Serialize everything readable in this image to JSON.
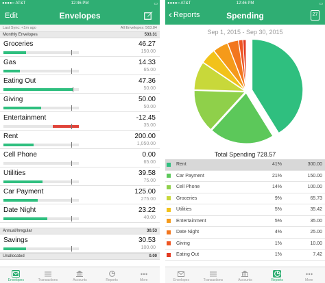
{
  "left": {
    "status": {
      "carrier": "●●●●○ AT&T",
      "time": "12:46 PM",
      "battery": "▭"
    },
    "nav": {
      "edit": "Edit",
      "title": "Envelopes",
      "edit_icon": "compose-icon"
    },
    "sync": {
      "last": "Last Sync: <1m ago",
      "all": "All Envelopes: 563.84"
    },
    "sections": {
      "monthly": {
        "label": "Monthly Envelopes",
        "value": "533.31"
      },
      "annual": {
        "label": "Annual/Irregular",
        "value": "30.53"
      },
      "unalloc": {
        "label": "Unallocated",
        "value": "0.00"
      }
    },
    "envelopes": [
      {
        "name": "Groceries",
        "balance": "46.27",
        "budget": "150.00",
        "fill": 0.3,
        "tick": 0.9,
        "color": "#2fbf7f"
      },
      {
        "name": "Gas",
        "balance": "14.33",
        "budget": "65.00",
        "fill": 0.22,
        "tick": 0.9,
        "color": "#2fbf7f"
      },
      {
        "name": "Eating Out",
        "balance": "47.36",
        "budget": "50.00",
        "fill": 0.93,
        "tick": 0.92,
        "color": "#2fbf7f"
      },
      {
        "name": "Giving",
        "balance": "50.00",
        "budget": "50.00",
        "fill": 0.5,
        "tick": 0.9,
        "color": "#2fbf7f"
      },
      {
        "name": "Entertainment",
        "balance": "-12.45",
        "budget": "35.00",
        "fill": 0.35,
        "fillStart": 0.65,
        "tick": 0.9,
        "color": "#e0443a"
      },
      {
        "name": "Rent",
        "balance": "200.00",
        "budget": "1,050.00",
        "fill": 0.4,
        "tick": 0.9,
        "color": "#2fbf7f"
      },
      {
        "name": "Cell Phone",
        "balance": "0.00",
        "budget": "65.00",
        "fill": 0.0,
        "tick": 0.9,
        "color": "#2fbf7f"
      },
      {
        "name": "Utilities",
        "balance": "39.58",
        "budget": "75.00",
        "fill": 0.52,
        "tick": 0.9,
        "color": "#2fbf7f"
      },
      {
        "name": "Car Payment",
        "balance": "125.00",
        "budget": "275.00",
        "fill": 0.45,
        "tick": 0.9,
        "color": "#2fbf7f"
      },
      {
        "name": "Date Night",
        "balance": "23.22",
        "budget": "40.00",
        "fill": 0.58,
        "tick": 0.9,
        "color": "#2fbf7f"
      },
      {
        "name": "Savings",
        "balance": "30.53",
        "budget": "100.00",
        "fill": 0.3,
        "tick": 0.9,
        "color": "#2fbf7f"
      }
    ],
    "tabs": [
      {
        "label": "Envelopes",
        "icon": "envelope-icon",
        "active": true
      },
      {
        "label": "Transactions",
        "icon": "list-icon",
        "active": false
      },
      {
        "label": "Accounts",
        "icon": "bank-icon",
        "active": false
      },
      {
        "label": "Reports",
        "icon": "pie-icon",
        "active": false
      },
      {
        "label": "More",
        "icon": "more-icon",
        "active": false
      }
    ]
  },
  "right": {
    "status": {
      "carrier": "●●●●○ AT&T",
      "time": "12:46 PM",
      "battery": "▭"
    },
    "nav": {
      "back": "Reports",
      "title": "Spending",
      "calendar_day": "27"
    },
    "date_range": "Sep 1, 2015 - Sep 30, 2015",
    "total": "Total Spending 728.57",
    "chart_data": {
      "type": "pie",
      "categories": [
        "Rent",
        "Car Payment",
        "Cell Phone",
        "Groceries",
        "Utilities",
        "Entertainment",
        "Date Night",
        "Giving",
        "Eating Out"
      ],
      "values": [
        300.0,
        150.0,
        100.0,
        65.73,
        35.42,
        35.0,
        25.0,
        10.0,
        7.42
      ],
      "percent_labels": [
        "41%",
        "21%",
        "14%",
        "9%",
        "5%",
        "5%",
        "4%",
        "1%",
        "1%"
      ],
      "amount_labels": [
        "300.00",
        "150.00",
        "100.00",
        "65.73",
        "35.42",
        "35.00",
        "25.00",
        "10.00",
        "7.42"
      ],
      "colors": [
        "#2fbf7f",
        "#5cc85a",
        "#8fd04a",
        "#c8d83a",
        "#f2c21a",
        "#f59a1a",
        "#f2761e",
        "#ee5522",
        "#e23a22"
      ],
      "exploded": 0
    },
    "tabs": [
      {
        "label": "Envelopes",
        "icon": "envelope-icon",
        "active": false
      },
      {
        "label": "Transactions",
        "icon": "list-icon",
        "active": false
      },
      {
        "label": "Accounts",
        "icon": "bank-icon",
        "active": false
      },
      {
        "label": "Reports",
        "icon": "pie-icon",
        "active": true
      },
      {
        "label": "More",
        "icon": "more-icon",
        "active": false
      }
    ]
  }
}
